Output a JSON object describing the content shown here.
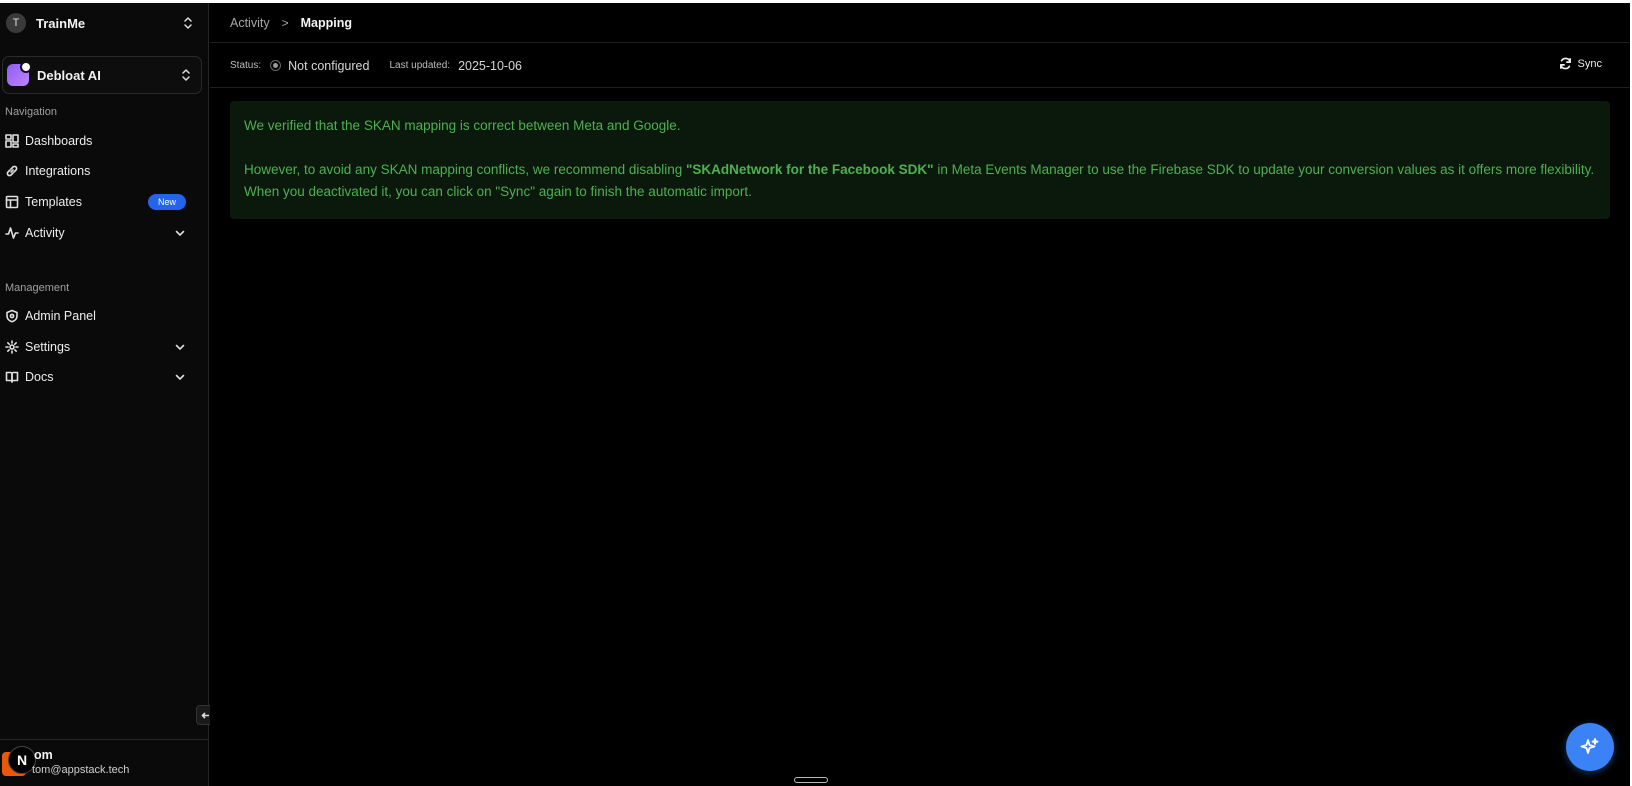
{
  "org": {
    "initial": "T",
    "name": "TrainMe"
  },
  "project": {
    "name": "Debloat AI"
  },
  "sidebar": {
    "navigation_label": "Navigation",
    "nav_items": [
      {
        "label": "Dashboards",
        "icon": "dashboard-icon"
      },
      {
        "label": "Integrations",
        "icon": "link-icon"
      },
      {
        "label": "Templates",
        "icon": "template-icon",
        "badge": "New"
      },
      {
        "label": "Activity",
        "icon": "activity-icon",
        "expandable": true
      }
    ],
    "management_label": "Management",
    "management_items": [
      {
        "label": "Admin Panel",
        "icon": "shield-icon"
      },
      {
        "label": "Settings",
        "icon": "gear-icon",
        "expandable": true
      },
      {
        "label": "Docs",
        "icon": "book-icon",
        "expandable": true
      }
    ]
  },
  "user": {
    "avatar_letter": "N",
    "name": "om",
    "email": "tom@appstack.tech"
  },
  "breadcrumb": {
    "parent": "Activity",
    "separator": ">",
    "current": "Mapping"
  },
  "status_bar": {
    "status_label": "Status:",
    "status_value": "Not configured",
    "last_updated_label": "Last updated:",
    "last_updated_value": "2025-10-06",
    "sync_label": "Sync"
  },
  "notice": {
    "line1": "We verified that the SKAN mapping is correct between Meta and Google.",
    "line2_pre": "However, to avoid any SKAN mapping conflicts, we recommend disabling ",
    "line2_bold": "\"SKAdNetwork for the Facebook SDK\"",
    "line2_post": " in Meta Events Manager to use the Firebase SDK to update your conversion values as it offers more flexibility. When you deactivated it, you can click on \"Sync\" again to finish the automatic import."
  },
  "colors": {
    "accent_blue": "#3b82f6",
    "notice_text": "#4fb051",
    "notice_bg": "#0b180c",
    "badge_bg": "#2563eb"
  }
}
